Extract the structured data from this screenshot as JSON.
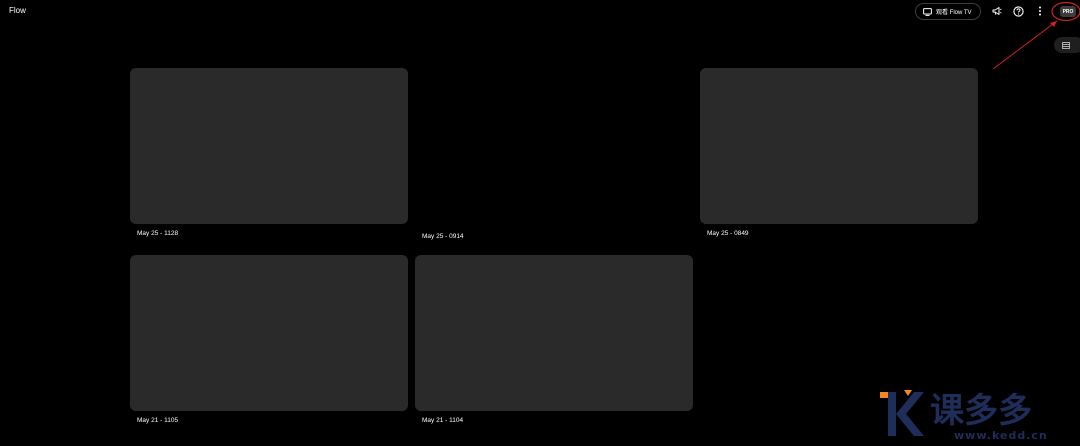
{
  "header": {
    "app_title": "Flow",
    "tv_button_label": "观看 Flow TV",
    "pro_badge": "PRO"
  },
  "icons": {
    "tv": "tv-icon",
    "announcement": "megaphone-icon",
    "help": "help-icon",
    "more": "more-vert-icon",
    "view": "grid-view-icon"
  },
  "projects": [
    {
      "label": "May 25 - 1128"
    },
    {
      "label": "May 25 - 0914"
    },
    {
      "label": "May 25 - 0849"
    },
    {
      "label": "May 21 - 1105"
    },
    {
      "label": "May 21 - 1104"
    }
  ],
  "watermark": {
    "brand": "课多多",
    "url": "www.kedd.cn"
  },
  "colors": {
    "background": "#000000",
    "card": "#2a2a2a",
    "annotation": "#d42020",
    "watermark_orange": "#f08a1c",
    "watermark_blue": "#1f2d5a"
  }
}
